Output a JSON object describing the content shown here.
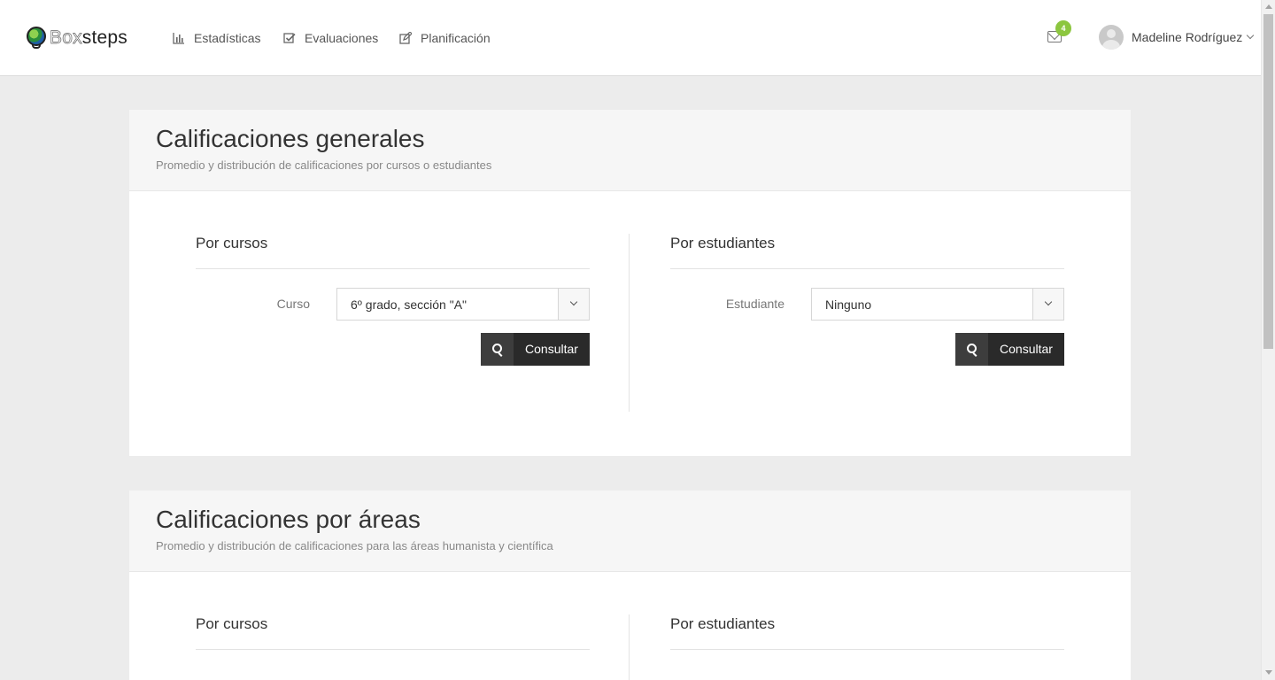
{
  "nav": {
    "brand": {
      "prefix": "Box",
      "suffix": "steps"
    },
    "items": [
      {
        "label": "Estadísticas",
        "icon": "bar-chart-icon"
      },
      {
        "label": "Evaluaciones",
        "icon": "check-square-icon"
      },
      {
        "label": "Planificación",
        "icon": "edit-icon"
      }
    ],
    "notifications": "4",
    "user": "Madeline Rodríguez"
  },
  "sections": [
    {
      "title": "Calificaciones generales",
      "subtitle": "Promedio y distribución de calificaciones por cursos o estudiantes",
      "by_course": {
        "title": "Por cursos",
        "label": "Curso",
        "value": "6º grado, sección \"A\"",
        "button": "Consultar"
      },
      "by_student": {
        "title": "Por estudiantes",
        "label": "Estudiante",
        "value": "Ninguno",
        "button": "Consultar"
      }
    },
    {
      "title": "Calificaciones por áreas",
      "subtitle": "Promedio y distribución de calificaciones para las áreas humanista y científica",
      "by_course": {
        "title": "Por cursos"
      },
      "by_student": {
        "title": "Por estudiantes"
      }
    }
  ],
  "colors": {
    "accent_badge": "#8cc63f",
    "button_bg": "#2a2a2a"
  }
}
